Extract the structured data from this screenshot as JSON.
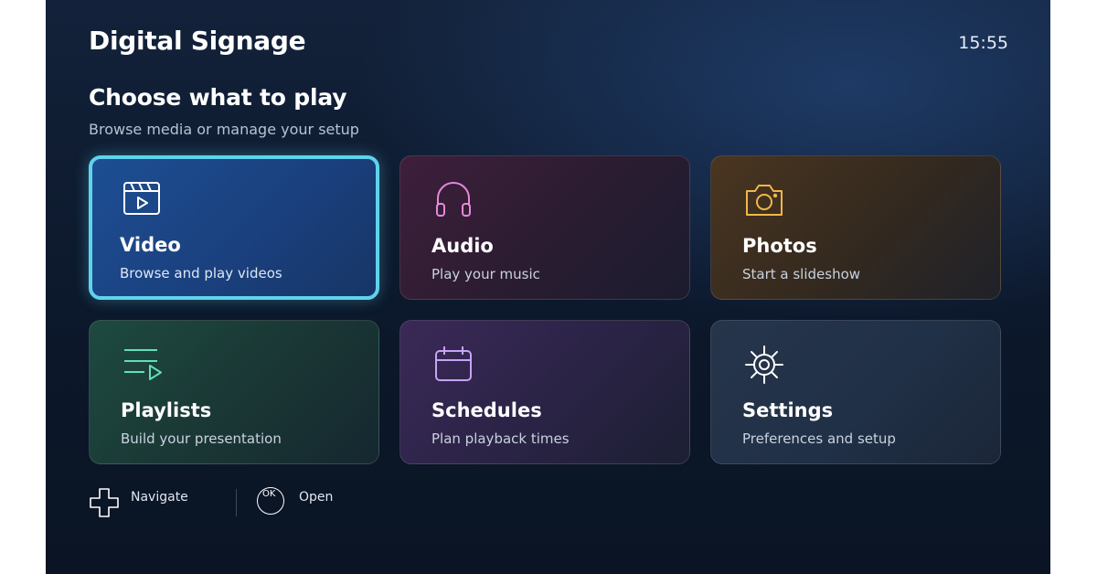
{
  "header": {
    "app_title": "Digital Signage",
    "clock": "15:55"
  },
  "main": {
    "heading": "Choose what to play",
    "subheading": "Browse media or manage your setup",
    "cards": [
      {
        "title": "Video",
        "description": "Browse and play videos",
        "icon": "video-clapper-icon",
        "accent": "#ffffff",
        "focused": true
      },
      {
        "title": "Audio",
        "description": "Play your music",
        "icon": "headphones-icon",
        "accent": "#e48ad8"
      },
      {
        "title": "Photos",
        "description": "Start a slideshow",
        "icon": "camera-icon",
        "accent": "#f0b84a"
      },
      {
        "title": "Playlists",
        "description": "Build your presentation",
        "icon": "playlist-icon",
        "accent": "#5fe0b8"
      },
      {
        "title": "Schedules",
        "description": "Plan playback times",
        "icon": "calendar-icon",
        "accent": "#c7a3f5"
      },
      {
        "title": "Settings",
        "description": "Preferences and setup",
        "icon": "gear-icon",
        "accent": "#ffffff"
      }
    ],
    "focus_color": "#5fd3ee"
  },
  "hints": {
    "navigate": {
      "label": "Navigate",
      "icon": "dpad-icon"
    },
    "open": {
      "label": "Open",
      "icon": "ok-button-icon",
      "key_text": "OK"
    }
  }
}
